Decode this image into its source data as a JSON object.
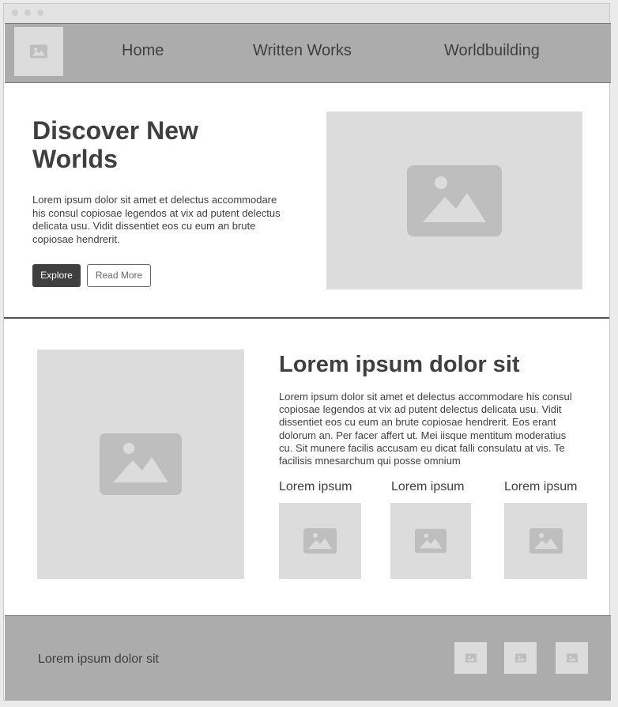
{
  "nav": {
    "items": [
      {
        "label": "Home"
      },
      {
        "label": "Written Works"
      },
      {
        "label": "Worldbuilding"
      }
    ]
  },
  "hero": {
    "title": "Discover New Worlds",
    "text": "Lorem ipsum dolor sit amet et delectus accommodare his consul copiosae legendos at vix ad putent delectus delicata usu. Vidit dissentiet eos cu eum an brute copiosae hendrerit.",
    "primary_button": "Explore",
    "secondary_button": "Read More"
  },
  "feature": {
    "title": "Lorem ipsum dolor sit",
    "text": "Lorem ipsum dolor sit amet et delectus accommodare his consul copiosae legendos at vix ad putent delectus delicata usu. Vidit dissentiet eos cu eum an brute copiosae hendrerit. Eos erant dolorum an. Per facer affert ut. Mei iisque mentitum moderatius cu. Sit munere facilis accusam eu dicat falli consulatu at vis. Te facilisis mnesarchum qui posse omnium",
    "cards": [
      {
        "caption": "Lorem ipsum"
      },
      {
        "caption": "Lorem ipsum"
      },
      {
        "caption": "Lorem ipsum"
      }
    ]
  },
  "footer": {
    "text": "Lorem ipsum dolor sit"
  },
  "icons": {
    "logo": "image-placeholder-icon",
    "placeholder": "image-placeholder-icon"
  },
  "colors": {
    "nav_bg": "#acacac",
    "placeholder_bg": "#dcdcdc",
    "placeholder_icon": "#bebebe",
    "text": "#3f3f3f"
  }
}
